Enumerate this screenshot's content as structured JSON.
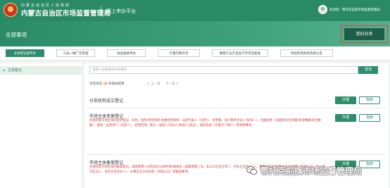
{
  "header": {
    "org_small": "内蒙古自治区人民政府",
    "org_name": "内蒙古自治区市场监督管理局",
    "platform": "网上申办平台",
    "welcome": "欢迎您：鄂托克前旗市场监督管理局"
  },
  "banner": {
    "title": "全部事项",
    "my_business": "我的业务"
  },
  "tabs": [
    {
      "label": "主体登记类申办",
      "active": true
    },
    {
      "label": "三品一械广告审查",
      "active": false
    },
    {
      "label": "食品相关申办",
      "active": false
    },
    {
      "label": "计量行政许可",
      "active": false
    },
    {
      "label": "重要工业产品生产许可证核发",
      "active": false
    },
    {
      "label": "检验检测机构资质认定",
      "active": false
    }
  ],
  "sidebar": {
    "items": [
      {
        "label": "主体登记"
      }
    ]
  },
  "search": {
    "placeholder": "请输入您要查找的关键字",
    "button": "查询"
  },
  "results": {
    "prefix": "为您找到",
    "count": "16",
    "suffix": "条相关结果",
    "pager_prev": "< 上一页",
    "pager_next": "下一页 >"
  },
  "items": [
    {
      "title": "分支机构设立登记",
      "desc": "",
      "do_label": "办理",
      "guide_label": "指南"
    },
    {
      "title": "市场主体变更登记",
      "desc": "办理改变市场主体的变更登记。名称、住所/经营场所/主要经营场所、法定代表人（负责人、经营者、执行事务合伙人/投资人）、注册资本（注册资金/出资额/资金数额/资金数额）、类型、主营部门（出资人）、经营范围、股东（发起人/合伙人/投资人/成员）、组成形式（仅限于个体户）等变更事项。",
      "do_label": "办理",
      "guide_label": "指南"
    },
    {
      "title": "市场主体备案登记",
      "desc": "办理改变市场主体的备案登记。高级管理人员的成员/法律代表/联络员（高级管理人员、非公司企业负责人、合伙企业合伙人）、董事会成员/监事会成员/经理（仅限公司、非公司企业法人、合伙企业合伙人）、从事设立分支机构（仅限公司）等备案事项。",
      "do_label": "办理",
      "guide_label": "指南"
    }
  ],
  "watermark": {
    "text": "鄂托克前旗市场监督管理局"
  },
  "colors": {
    "primary": "#2e8d6a",
    "header": "#2a8a66",
    "my_business_bg": "#1f5d4b",
    "highlight_outline": "#d9453c",
    "desc_text": "#d23a3a",
    "count_accent": "#e0752c"
  }
}
